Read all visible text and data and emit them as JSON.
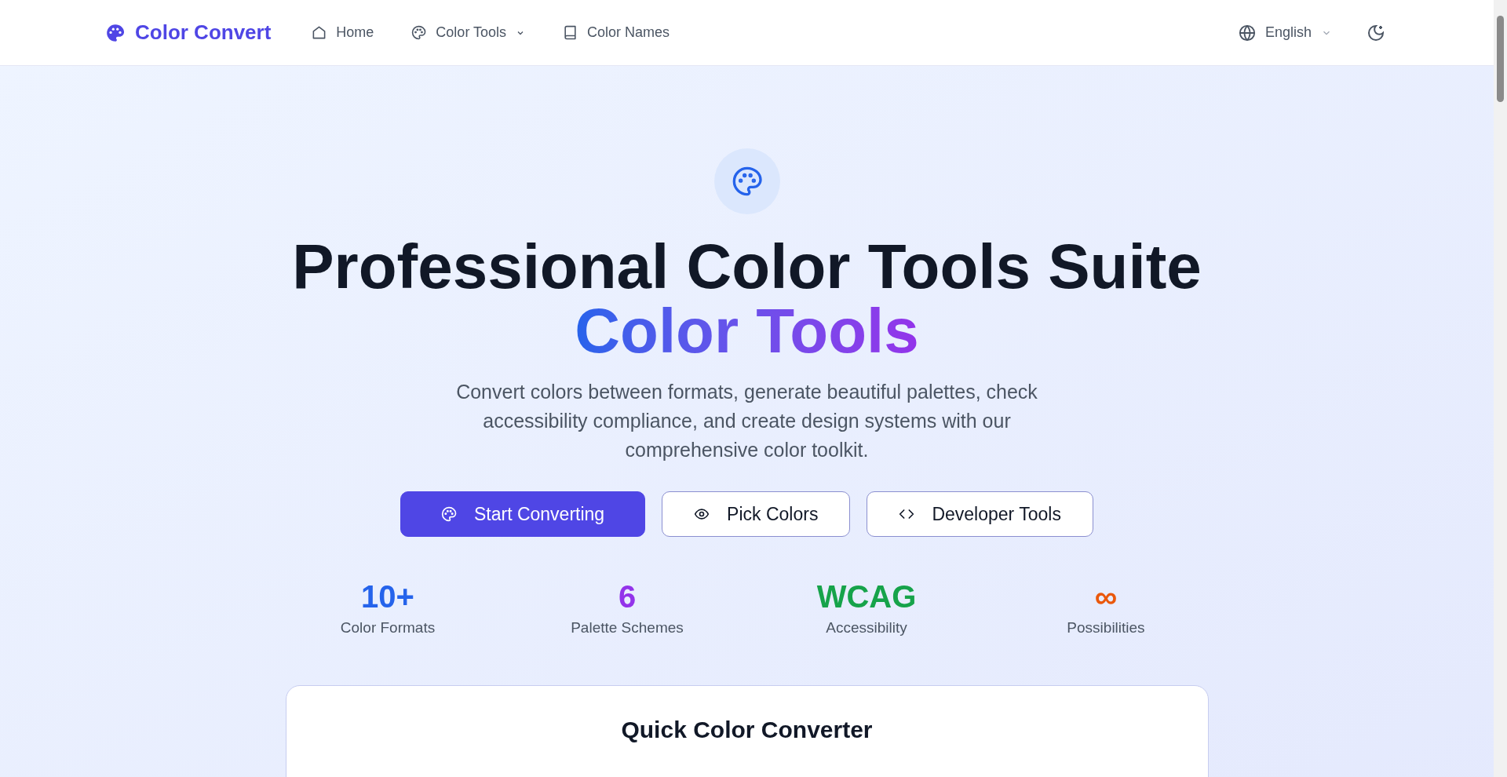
{
  "nav": {
    "brand": "Color Convert",
    "items": [
      {
        "label": "Home",
        "dropdown": false
      },
      {
        "label": "Color Tools",
        "dropdown": true
      },
      {
        "label": "Color Names",
        "dropdown": false
      }
    ],
    "language": "English"
  },
  "hero": {
    "title": "Professional Color Tools Suite",
    "highlight": "Color Tools",
    "subtitle": "Convert colors between formats, generate beautiful palettes, check accessibility compliance, and create design systems with our comprehensive color toolkit.",
    "buttons": [
      {
        "label": "Start Converting",
        "kind": "primary"
      },
      {
        "label": "Pick Colors",
        "kind": "outline"
      },
      {
        "label": "Developer Tools",
        "kind": "outline"
      }
    ],
    "stats": [
      {
        "value": "10+",
        "label": "Color Formats",
        "color": "#2563eb"
      },
      {
        "value": "6",
        "label": "Palette Schemes",
        "color": "#9333ea"
      },
      {
        "value": "WCAG",
        "label": "Accessibility",
        "color": "#16a34a"
      },
      {
        "value": "∞",
        "label": "Possibilities",
        "color": "#ea580c"
      }
    ]
  },
  "converter": {
    "title": "Quick Color Converter"
  }
}
